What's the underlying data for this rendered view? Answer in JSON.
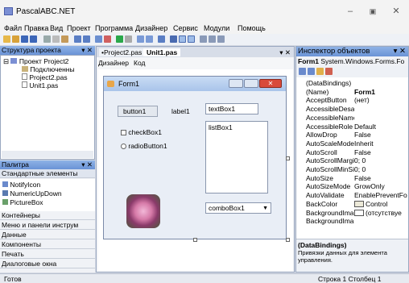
{
  "window": {
    "title": "PascalABC.NET"
  },
  "menu": [
    "Файл",
    "Правка",
    "Вид",
    "Проект",
    "Программа",
    "Дизайнер",
    "Сервис",
    "Модули",
    "Помощь"
  ],
  "project_panel": {
    "title": "Структура проекта",
    "pin": "▾ ✕",
    "items": [
      "Проект Project2",
      "Подключенны",
      "Project2.pas",
      "Unit1.pas"
    ]
  },
  "palette_panel": {
    "title": "Палитра",
    "pin": "▾ ✕",
    "category": "Стандартные элементы",
    "items": [
      "NotifyIcon",
      "NumericUpDown",
      "PictureBox"
    ],
    "groups": [
      "Контейнеры",
      "Меню и панели инструм",
      "Данные",
      "Компоненты",
      "Печать",
      "Диалоговые окна"
    ]
  },
  "editor": {
    "tabs": [
      "•Project2.pas",
      "Unit1.pas"
    ],
    "close": "▾ ✕",
    "subtabs": [
      "Дизайнер",
      "Код"
    ]
  },
  "form": {
    "title": "Form1",
    "button": "button1",
    "label": "label1",
    "textbox": "textBox1",
    "checkbox": "checkBox1",
    "radio": "radioButton1",
    "listbox": "listBox1",
    "combobox": "comboBox1"
  },
  "inspector": {
    "title": "Инспектор объектов",
    "pin": "▾ ✕",
    "object": "Form1",
    "object_type": "System.Windows.Forms.Fo",
    "props": [
      [
        "(DataBindings)",
        ""
      ],
      [
        "(Name)",
        "Form1"
      ],
      [
        "AcceptButton",
        "(нет)"
      ],
      [
        "AccessibleDesa",
        ""
      ],
      [
        "AccessibleName",
        ""
      ],
      [
        "AccessibleRole",
        "Default"
      ],
      [
        "AllowDrop",
        "False"
      ],
      [
        "AutoScaleMode",
        "Inherit"
      ],
      [
        "AutoScroll",
        "False"
      ],
      [
        "AutoScrollMargi",
        "0; 0"
      ],
      [
        "AutoScrollMinSi",
        "0; 0"
      ],
      [
        "AutoSize",
        "False"
      ],
      [
        "AutoSizeMode",
        "GrowOnly"
      ],
      [
        "AutoValidate",
        "EnablePreventFo"
      ],
      [
        "BackColor",
        "Control"
      ],
      [
        "BackgroundIma",
        "(отсутствуе"
      ],
      [
        "BackgroundIma",
        ""
      ]
    ],
    "desc_title": "(DataBindings)",
    "desc_text": "Привязки данных для элемента управления."
  },
  "status": {
    "left": "Готов",
    "right": "Строка 1 Столбец 1"
  }
}
